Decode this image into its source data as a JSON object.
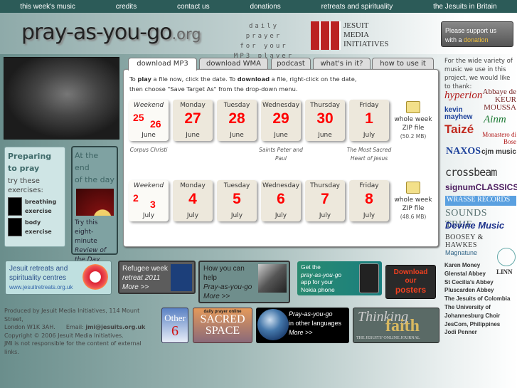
{
  "nav": [
    "this week's music",
    "credits",
    "contact us",
    "donations",
    "retreats and spirituality",
    "the Jesuits in Britain"
  ],
  "header": {
    "logo_main": "pray-as-you-go",
    "logo_suffix": ".org",
    "tagline": [
      "daily prayer",
      "for your",
      "MP3 player"
    ],
    "jmi": [
      "JESUIT",
      "MEDIA",
      "INITIATIVES"
    ],
    "donate_line1": "Please support us",
    "donate_line2": "with a",
    "donate_link": "donation"
  },
  "sidebar": {
    "preparing": {
      "title1": "Preparing",
      "title2": "to pray",
      "sub": "try these exercises:",
      "items": [
        {
          "l1": "breathing",
          "l2": "exercise"
        },
        {
          "l1": "body",
          "l2": "exercise"
        }
      ]
    },
    "end_of_day": {
      "title1": "At the end",
      "title2": "of the day",
      "text": "Try this eight-minute",
      "link": "Review of the Day"
    }
  },
  "tabs": [
    "download MP3",
    "download WMA",
    "podcast",
    "what's in it?",
    "how to use it"
  ],
  "instructions": {
    "a": "To ",
    "play": "play",
    "b": " a file now, click the date.    To ",
    "download": "download",
    "c": " a file, right-click on the date,",
    "line2": "then choose \"Save Target As\" from the drop-down menu."
  },
  "weeks": [
    {
      "days": [
        {
          "day": "Weekend",
          "n1": "25",
          "n2": "26",
          "month": "June",
          "note": "Corpus Christi"
        },
        {
          "day": "Monday",
          "n": "27",
          "month": "June"
        },
        {
          "day": "Tuesday",
          "n": "28",
          "month": "June"
        },
        {
          "day": "Wednesday",
          "n": "29",
          "month": "June",
          "note": "Saints Peter and Paul"
        },
        {
          "day": "Thursday",
          "n": "30",
          "month": "June"
        },
        {
          "day": "Friday",
          "n": "1",
          "month": "July",
          "note": "The Most Sacred Heart of Jesus"
        }
      ],
      "zip_label1": "whole week",
      "zip_label2": "ZIP file",
      "zip_size": "(50.2 MB)"
    },
    {
      "days": [
        {
          "day": "Weekend",
          "n1": "2",
          "n2": "3",
          "month": "July"
        },
        {
          "day": "Monday",
          "n": "4",
          "month": "July"
        },
        {
          "day": "Tuesday",
          "n": "5",
          "month": "July"
        },
        {
          "day": "Wednesday",
          "n": "6",
          "month": "July"
        },
        {
          "day": "Thursday",
          "n": "7",
          "month": "July"
        },
        {
          "day": "Friday",
          "n": "8",
          "month": "July"
        }
      ],
      "zip_label1": "whole week",
      "zip_label2": "ZIP file",
      "zip_size": "(48.6 MB)"
    }
  ],
  "thanks": {
    "intro": "For the wide variety of music we use in this project, we would like to thank:",
    "logos": [
      "hyperion",
      "Abbaye de KEUR MOUSSA",
      "kevin mayhew",
      "Ainm",
      "Taizé",
      "Monastero di Bose",
      "NAXOS",
      "cjm music",
      "crossbeam",
      "signumCLASSICS",
      "WRASSE RECORDS",
      "SOUNDS TRUE",
      "Devine Music",
      "BOOSEY & HAWKES",
      "Magnatune",
      "LINN"
    ],
    "names": [
      "Karen Money",
      "Glenstal Abbey",
      "St Cecilia's Abbey",
      "Pluscarden Abbey",
      "The Jesuits of Colombia",
      "The University of",
      "Johannesburg Choir",
      "JesCom, Philippines",
      "Jodi Penner"
    ]
  },
  "banners": {
    "retreats": {
      "l1": "Jesuit retreats and",
      "l2": "spirituality centres",
      "url": "www.jesuitretreats.org.uk"
    },
    "refugee": {
      "l1": "Refugee week",
      "l2": "retreat 2011",
      "more": "More >>"
    },
    "help": {
      "l1": "How you can",
      "l2": "help",
      "l3": "Pray-as-you-go",
      "more": "More >>"
    },
    "app": {
      "l1": "Get the",
      "l2": "pray-as-you-go",
      "l3": "app for your",
      "l4": "Nokia phone"
    },
    "posters": {
      "l1": "Download",
      "l2": "our",
      "l3": "posters"
    },
    "other6": {
      "l1": "Other",
      "l2": "6"
    },
    "sacred": {
      "top": "daily prayer online",
      "l1": "SACRED",
      "l2": "SPACE"
    },
    "languages": {
      "l1": "Pray-as-you-go",
      "l2": "in other languages",
      "more": "More >>"
    },
    "faith": {
      "l1": "Thinking",
      "l2": "faith",
      "l3": "THE JESUITS' ONLINE JOURNAL"
    }
  },
  "footer": {
    "l1": "Produced by Jesuit Media Initiatives, 114 Mount Street,",
    "l2": "London W1K 3AH.",
    "email_label": "Email:",
    "email": "jmi@jesuits.org.uk",
    "l3": "Copyright © 2006 Jesuit Media Initiatives.",
    "l4": "JMI is not responsible for the content of external links."
  }
}
